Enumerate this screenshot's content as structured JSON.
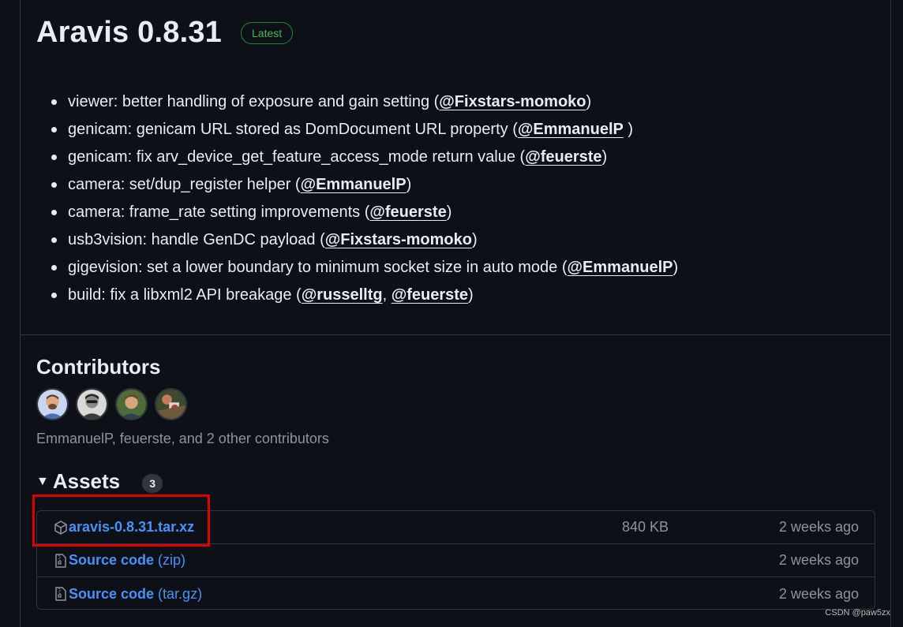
{
  "release": {
    "title": "Aravis 0.8.31",
    "badge": "Latest"
  },
  "notes": [
    {
      "text": "viewer: better handling of exposure and gain setting (",
      "mentions": [
        "@Fixstars-momoko"
      ],
      "suffix": ")"
    },
    {
      "text": "genicam: genicam URL stored as DomDocument URL property (",
      "mentions": [
        "@EmmanuelP"
      ],
      "suffix": " )"
    },
    {
      "text": "genicam: fix arv_device_get_feature_access_mode return value (",
      "mentions": [
        "@feuerste"
      ],
      "suffix": ")"
    },
    {
      "text": "camera: set/dup_register helper (",
      "mentions": [
        "@EmmanuelP"
      ],
      "suffix": ")"
    },
    {
      "text": "camera: frame_rate setting improvements (",
      "mentions": [
        "@feuerste"
      ],
      "suffix": ")"
    },
    {
      "text": "usb3vision: handle GenDC payload (",
      "mentions": [
        "@Fixstars-momoko"
      ],
      "suffix": ")"
    },
    {
      "text": "gigevision: set a lower boundary to minimum socket size in auto mode (",
      "mentions": [
        "@EmmanuelP"
      ],
      "suffix": ")"
    },
    {
      "text": "build: fix a libxml2 API breakage (",
      "mentions": [
        "@russelltg",
        "@feuerste"
      ],
      "suffix": ")"
    }
  ],
  "contributors": {
    "title": "Contributors",
    "summary": "EmmanuelP, feuerste, and 2 other contributors"
  },
  "assets": {
    "title": "Assets",
    "count": "3",
    "items": [
      {
        "name": "aravis-0.8.31.tar.xz",
        "ext": "",
        "size": "840 KB",
        "date": "2 weeks ago",
        "icon": "package-icon"
      },
      {
        "name": "Source code",
        "ext": " (zip)",
        "size": "",
        "date": "2 weeks ago",
        "icon": "file-zip-icon"
      },
      {
        "name": "Source code",
        "ext": " (tar.gz)",
        "size": "",
        "date": "2 weeks ago",
        "icon": "file-zip-icon"
      }
    ]
  },
  "watermark": "CSDN @paw5zx",
  "colors": {
    "background": "#0d1117",
    "border": "#30363d",
    "link": "#4493f8",
    "latest": "#3fb950",
    "highlight": "#e00000"
  }
}
